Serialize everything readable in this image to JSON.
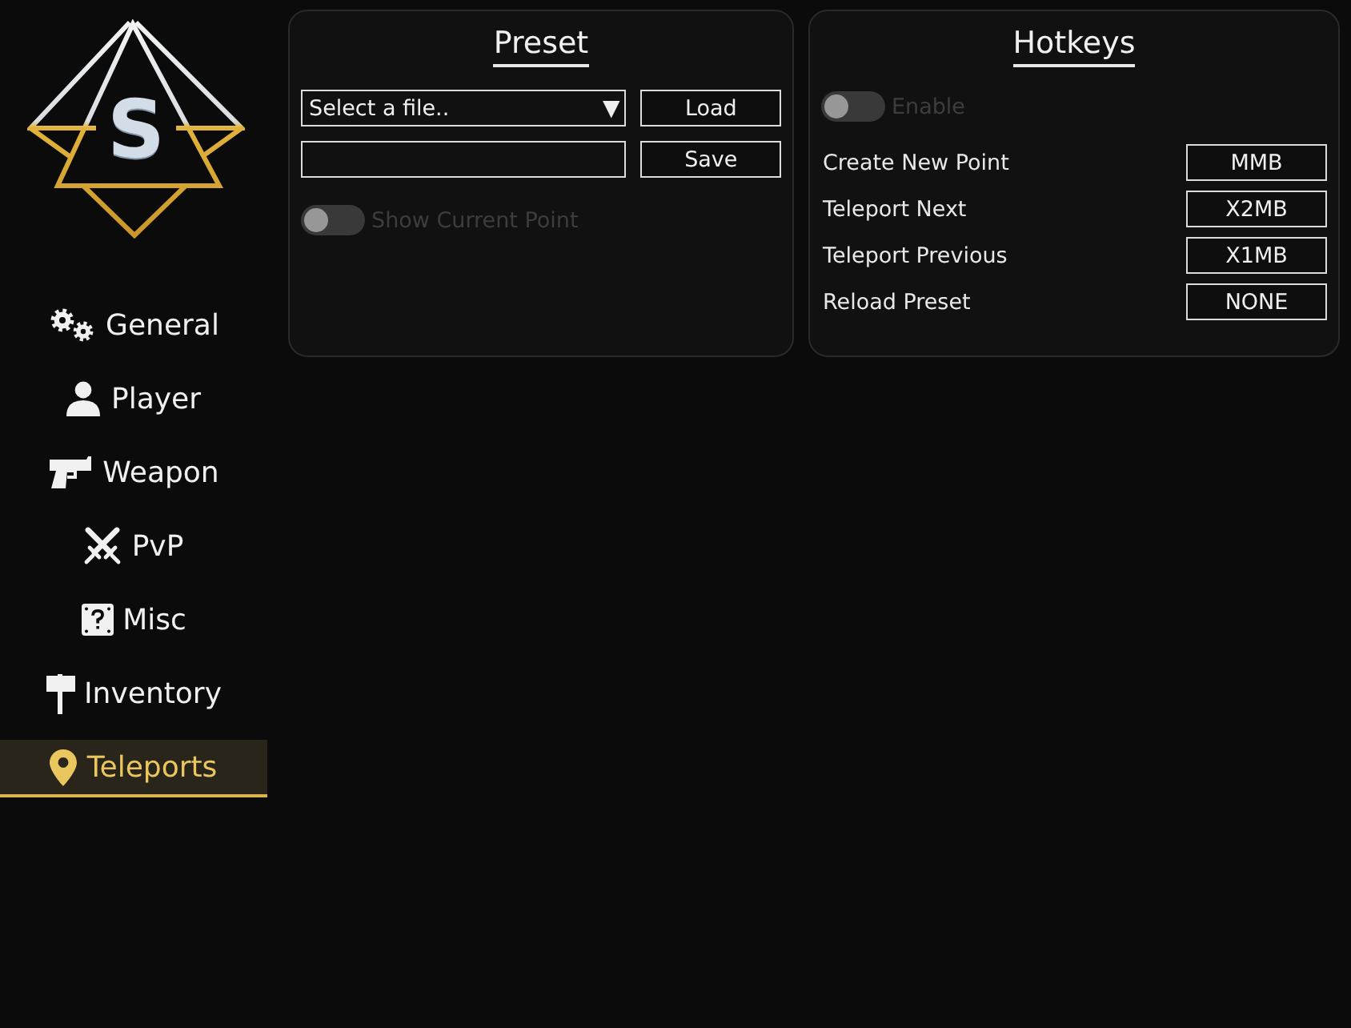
{
  "logo": {
    "letter": "S"
  },
  "sidebar": {
    "items": [
      {
        "label": "General",
        "selected": false
      },
      {
        "label": "Player",
        "selected": false
      },
      {
        "label": "Weapon",
        "selected": false
      },
      {
        "label": "PvP",
        "selected": false
      },
      {
        "label": "Misc",
        "selected": false
      },
      {
        "label": "Inventory",
        "selected": false
      },
      {
        "label": "Teleports",
        "selected": true
      }
    ]
  },
  "preset": {
    "title": "Preset",
    "file_select": {
      "value": "Select a file..",
      "arrow": "▼"
    },
    "load_button": "Load",
    "save_button": "Save",
    "toggle": {
      "label": "Show Current Point",
      "on": false,
      "disabled": true
    }
  },
  "hotkeys": {
    "title": "Hotkeys",
    "toggle": {
      "label": "Enable",
      "on": false,
      "disabled": true
    },
    "bindings": [
      {
        "label": "Create New Point",
        "key": "MMB"
      },
      {
        "label": "Teleport Next",
        "key": "X2MB"
      },
      {
        "label": "Teleport Previous",
        "key": "X1MB"
      },
      {
        "label": "Reload Preset",
        "key": "NONE"
      }
    ]
  }
}
